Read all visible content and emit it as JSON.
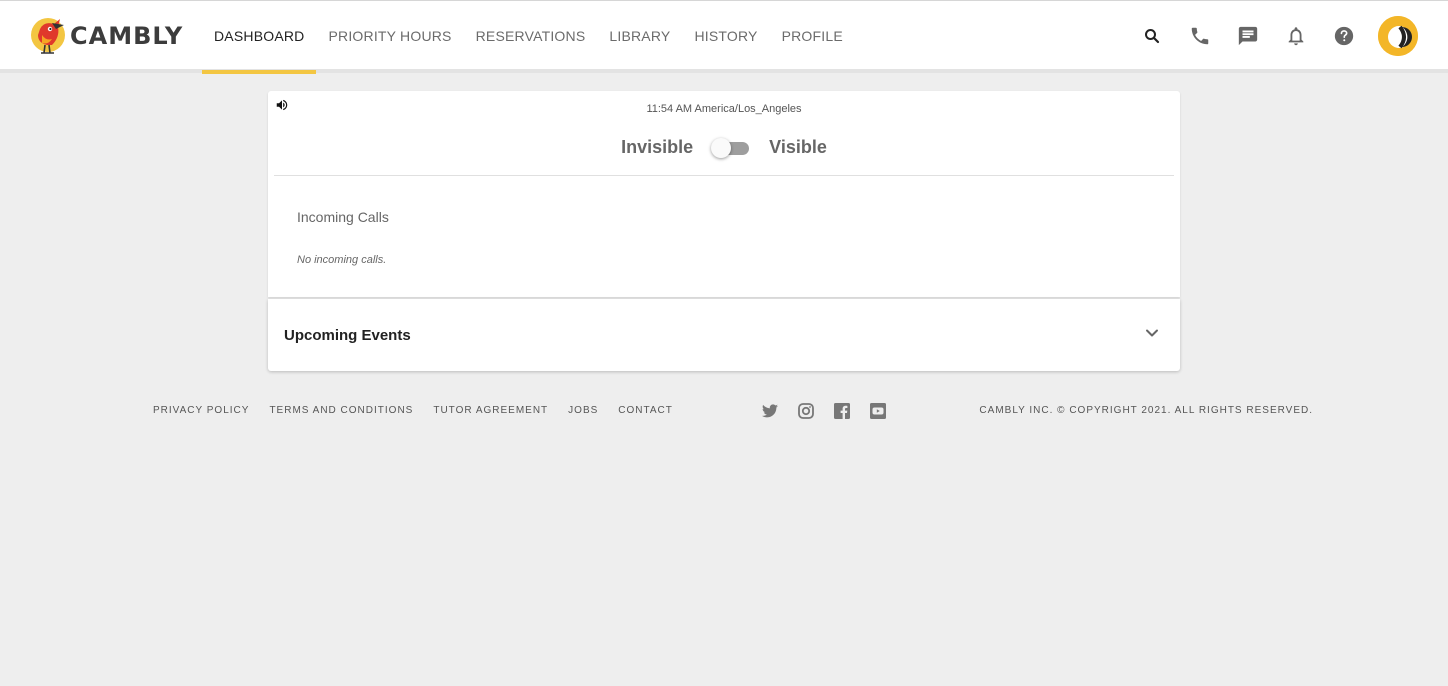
{
  "brand": {
    "name": "CAMBLY",
    "accent_color": "#f3c642"
  },
  "nav": {
    "items": [
      {
        "label": "DASHBOARD",
        "active": true
      },
      {
        "label": "PRIORITY HOURS",
        "active": false
      },
      {
        "label": "RESERVATIONS",
        "active": false
      },
      {
        "label": "LIBRARY",
        "active": false
      },
      {
        "label": "HISTORY",
        "active": false
      },
      {
        "label": "PROFILE",
        "active": false
      }
    ]
  },
  "header_icons": [
    "search-icon",
    "phone-icon",
    "chat-icon",
    "bell-icon",
    "help-icon",
    "avatar"
  ],
  "dashboard": {
    "sound_icon": "volume-icon",
    "clock": "11:54 AM America/Los_Angeles",
    "visibility": {
      "off_label": "Invisible",
      "on_label": "Visible",
      "state": "off"
    },
    "incoming_calls": {
      "title": "Incoming Calls",
      "empty_text": "No incoming calls."
    }
  },
  "upcoming_events": {
    "title": "Upcoming Events",
    "expanded": false
  },
  "footer": {
    "links": [
      "PRIVACY POLICY",
      "TERMS AND CONDITIONS",
      "TUTOR AGREEMENT",
      "JOBS",
      "CONTACT"
    ],
    "social": [
      "twitter-icon",
      "instagram-icon",
      "facebook-icon",
      "youtube-icon"
    ],
    "copyright": "CAMBLY INC. © COPYRIGHT 2021. ALL RIGHTS RESERVED."
  }
}
